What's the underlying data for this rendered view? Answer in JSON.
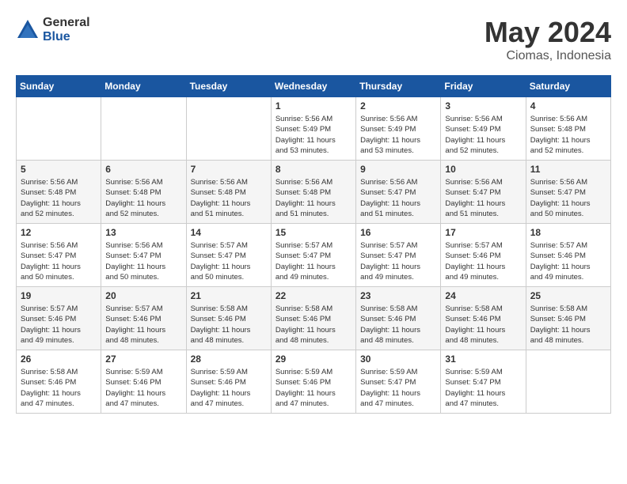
{
  "header": {
    "logo_general": "General",
    "logo_blue": "Blue",
    "month_year": "May 2024",
    "location": "Ciomas, Indonesia"
  },
  "weekdays": [
    "Sunday",
    "Monday",
    "Tuesday",
    "Wednesday",
    "Thursday",
    "Friday",
    "Saturday"
  ],
  "weeks": [
    [
      {
        "day": "",
        "info": ""
      },
      {
        "day": "",
        "info": ""
      },
      {
        "day": "",
        "info": ""
      },
      {
        "day": "1",
        "info": "Sunrise: 5:56 AM\nSunset: 5:49 PM\nDaylight: 11 hours\nand 53 minutes."
      },
      {
        "day": "2",
        "info": "Sunrise: 5:56 AM\nSunset: 5:49 PM\nDaylight: 11 hours\nand 53 minutes."
      },
      {
        "day": "3",
        "info": "Sunrise: 5:56 AM\nSunset: 5:49 PM\nDaylight: 11 hours\nand 52 minutes."
      },
      {
        "day": "4",
        "info": "Sunrise: 5:56 AM\nSunset: 5:48 PM\nDaylight: 11 hours\nand 52 minutes."
      }
    ],
    [
      {
        "day": "5",
        "info": "Sunrise: 5:56 AM\nSunset: 5:48 PM\nDaylight: 11 hours\nand 52 minutes."
      },
      {
        "day": "6",
        "info": "Sunrise: 5:56 AM\nSunset: 5:48 PM\nDaylight: 11 hours\nand 52 minutes."
      },
      {
        "day": "7",
        "info": "Sunrise: 5:56 AM\nSunset: 5:48 PM\nDaylight: 11 hours\nand 51 minutes."
      },
      {
        "day": "8",
        "info": "Sunrise: 5:56 AM\nSunset: 5:48 PM\nDaylight: 11 hours\nand 51 minutes."
      },
      {
        "day": "9",
        "info": "Sunrise: 5:56 AM\nSunset: 5:47 PM\nDaylight: 11 hours\nand 51 minutes."
      },
      {
        "day": "10",
        "info": "Sunrise: 5:56 AM\nSunset: 5:47 PM\nDaylight: 11 hours\nand 51 minutes."
      },
      {
        "day": "11",
        "info": "Sunrise: 5:56 AM\nSunset: 5:47 PM\nDaylight: 11 hours\nand 50 minutes."
      }
    ],
    [
      {
        "day": "12",
        "info": "Sunrise: 5:56 AM\nSunset: 5:47 PM\nDaylight: 11 hours\nand 50 minutes."
      },
      {
        "day": "13",
        "info": "Sunrise: 5:56 AM\nSunset: 5:47 PM\nDaylight: 11 hours\nand 50 minutes."
      },
      {
        "day": "14",
        "info": "Sunrise: 5:57 AM\nSunset: 5:47 PM\nDaylight: 11 hours\nand 50 minutes."
      },
      {
        "day": "15",
        "info": "Sunrise: 5:57 AM\nSunset: 5:47 PM\nDaylight: 11 hours\nand 49 minutes."
      },
      {
        "day": "16",
        "info": "Sunrise: 5:57 AM\nSunset: 5:47 PM\nDaylight: 11 hours\nand 49 minutes."
      },
      {
        "day": "17",
        "info": "Sunrise: 5:57 AM\nSunset: 5:46 PM\nDaylight: 11 hours\nand 49 minutes."
      },
      {
        "day": "18",
        "info": "Sunrise: 5:57 AM\nSunset: 5:46 PM\nDaylight: 11 hours\nand 49 minutes."
      }
    ],
    [
      {
        "day": "19",
        "info": "Sunrise: 5:57 AM\nSunset: 5:46 PM\nDaylight: 11 hours\nand 49 minutes."
      },
      {
        "day": "20",
        "info": "Sunrise: 5:57 AM\nSunset: 5:46 PM\nDaylight: 11 hours\nand 48 minutes."
      },
      {
        "day": "21",
        "info": "Sunrise: 5:58 AM\nSunset: 5:46 PM\nDaylight: 11 hours\nand 48 minutes."
      },
      {
        "day": "22",
        "info": "Sunrise: 5:58 AM\nSunset: 5:46 PM\nDaylight: 11 hours\nand 48 minutes."
      },
      {
        "day": "23",
        "info": "Sunrise: 5:58 AM\nSunset: 5:46 PM\nDaylight: 11 hours\nand 48 minutes."
      },
      {
        "day": "24",
        "info": "Sunrise: 5:58 AM\nSunset: 5:46 PM\nDaylight: 11 hours\nand 48 minutes."
      },
      {
        "day": "25",
        "info": "Sunrise: 5:58 AM\nSunset: 5:46 PM\nDaylight: 11 hours\nand 48 minutes."
      }
    ],
    [
      {
        "day": "26",
        "info": "Sunrise: 5:58 AM\nSunset: 5:46 PM\nDaylight: 11 hours\nand 47 minutes."
      },
      {
        "day": "27",
        "info": "Sunrise: 5:59 AM\nSunset: 5:46 PM\nDaylight: 11 hours\nand 47 minutes."
      },
      {
        "day": "28",
        "info": "Sunrise: 5:59 AM\nSunset: 5:46 PM\nDaylight: 11 hours\nand 47 minutes."
      },
      {
        "day": "29",
        "info": "Sunrise: 5:59 AM\nSunset: 5:46 PM\nDaylight: 11 hours\nand 47 minutes."
      },
      {
        "day": "30",
        "info": "Sunrise: 5:59 AM\nSunset: 5:47 PM\nDaylight: 11 hours\nand 47 minutes."
      },
      {
        "day": "31",
        "info": "Sunrise: 5:59 AM\nSunset: 5:47 PM\nDaylight: 11 hours\nand 47 minutes."
      },
      {
        "day": "",
        "info": ""
      }
    ]
  ]
}
